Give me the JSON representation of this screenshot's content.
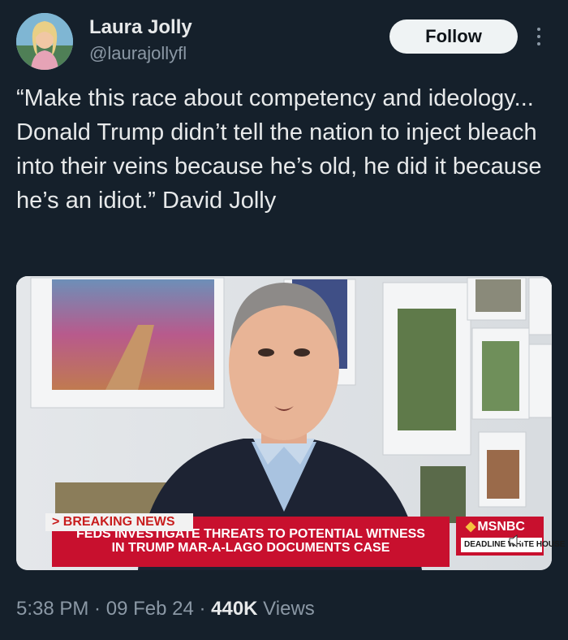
{
  "author": {
    "name": "Laura Jolly",
    "handle": "@laurajollyfl"
  },
  "follow_label": "Follow",
  "tweet": {
    "text": "“Make this race about competency and ideology... Donald Trump didn’t tell the nation to inject bleach into their veins because he’s old, he did it because he’s an idiot.” David Jolly"
  },
  "media": {
    "chyron": {
      "breaking": "> BREAKING NEWS",
      "line1": "FEDS INVESTIGATE THREATS TO POTENTIAL WITNESS",
      "line2": "IN TRUMP MAR-A-LAGO DOCUMENTS CASE",
      "network": "MSNBC",
      "show": "DEADLINE WHITE HOUSE"
    },
    "icons": {
      "mute": "mute-icon",
      "more": "more-icon",
      "network_logo": "peacock-icon"
    }
  },
  "meta": {
    "time": "5:38 PM",
    "sep": " · ",
    "date": "09 Feb 24",
    "views_count": "440K",
    "views_label": " Views"
  },
  "colors": {
    "background": "#15202b",
    "text": "#e7e9ea",
    "secondary": "#8b98a5",
    "follow_bg": "#eff3f4",
    "chyron_red": "#c8102e"
  }
}
